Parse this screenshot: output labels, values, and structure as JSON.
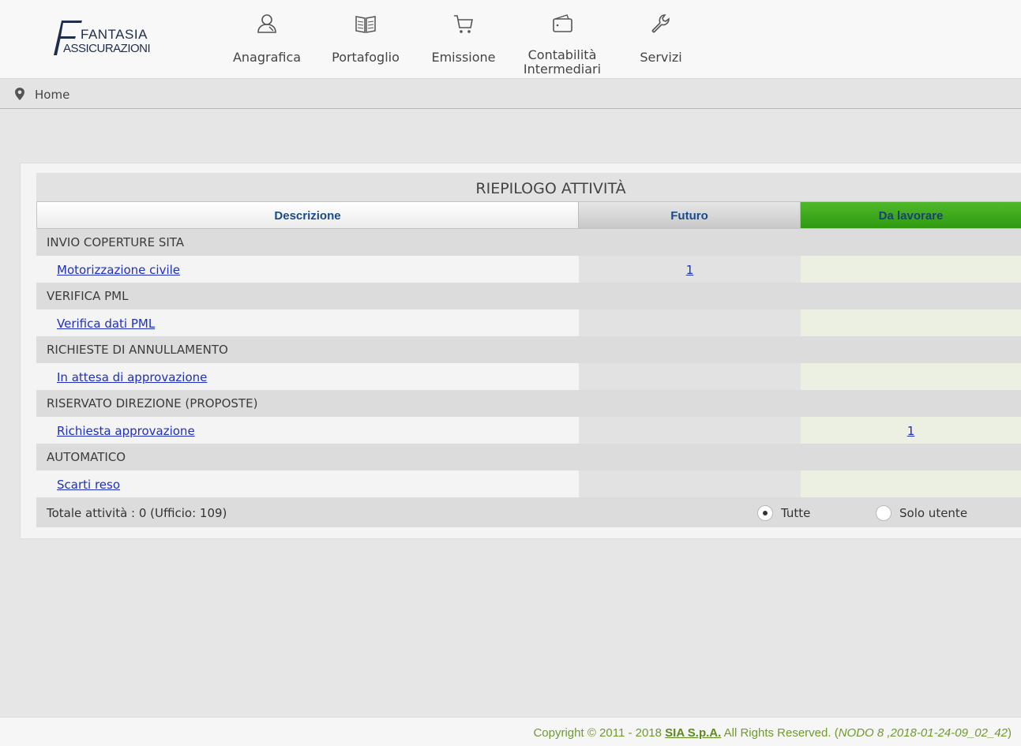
{
  "logo": {
    "line1": "FANTASIA",
    "line2": "ASSICURAZIONI"
  },
  "nav": [
    {
      "label": "Anagrafica",
      "icon": "user-icon"
    },
    {
      "label": "Portafoglio",
      "icon": "book-icon"
    },
    {
      "label": "Emissione",
      "icon": "cart-icon"
    },
    {
      "label": "Contabilità\nIntermediari",
      "icon": "wallet-icon"
    },
    {
      "label": "Servizi",
      "icon": "wrench-icon"
    }
  ],
  "breadcrumb": {
    "home": "Home",
    "icon": "map-pin-icon"
  },
  "table": {
    "title": "RIEPILOGO ATTIVITÀ",
    "headers": {
      "descrizione": "Descrizione",
      "futuro": "Futuro",
      "da_lavorare": "Da lavorare"
    },
    "groups": [
      {
        "name": "INVIO COPERTURE SITA",
        "item": {
          "label": "Motorizzazione civile",
          "futuro": "1",
          "da_lavorare": ""
        }
      },
      {
        "name": "VERIFICA PML",
        "item": {
          "label": "Verifica dati PML",
          "futuro": "",
          "da_lavorare": ""
        }
      },
      {
        "name": "RICHIESTE DI ANNULLAMENTO",
        "item": {
          "label": "In attesa di approvazione",
          "futuro": "",
          "da_lavorare": ""
        }
      },
      {
        "name": "RISERVATO DIREZIONE (PROPOSTE)",
        "item": {
          "label": "Richiesta approvazione",
          "futuro": "",
          "da_lavorare": "1"
        }
      },
      {
        "name": "AUTOMATICO",
        "item": {
          "label": "Scarti reso",
          "futuro": "",
          "da_lavorare": ""
        }
      }
    ],
    "total": "Totale attività : 0 (Ufficio: 109)",
    "filter": {
      "all": "Tutte",
      "user": "Solo utente",
      "selected": "Tutte"
    }
  },
  "footer": {
    "prefix": "Copyright © 2011 - 2018 ",
    "company": "SIA S.p.A.",
    "middle": " All Rights Reserved. (",
    "node": "NODO 8 ,2018-01-24-09_02_42",
    "suffix": ")"
  },
  "colors": {
    "header_text": "#184a8c",
    "accent_green": "#3aa81a",
    "link": "#1f2fbf",
    "footer_green": "#6f9a2f"
  }
}
